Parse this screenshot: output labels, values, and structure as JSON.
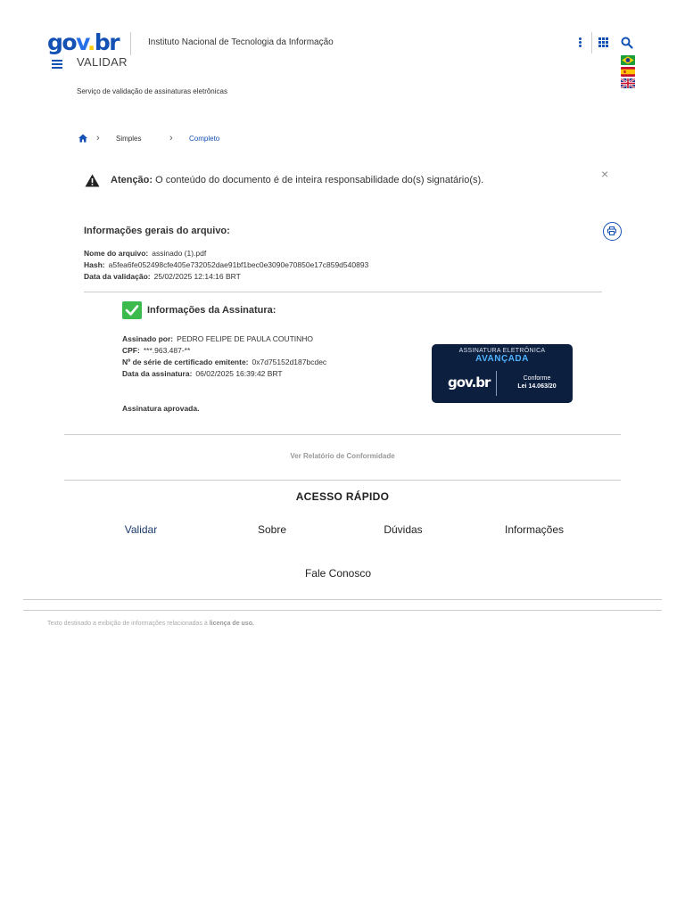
{
  "header": {
    "logo": {
      "g": "g",
      "o": "o",
      "v": "v",
      "dot": ".",
      "br": "br"
    },
    "institute": "Instituto Nacional de Tecnologia da Informação",
    "app_name": "VALIDAR",
    "subtitle": "Serviço de validação de assinaturas eletrônicas",
    "icons": [
      "kebab-icon",
      "grid-icon",
      "search-icon"
    ],
    "languages": [
      "flag-brazil",
      "flag-spain",
      "flag-uk"
    ]
  },
  "breadcrumb": {
    "items": [
      "Simples",
      "Completo"
    ]
  },
  "alert": {
    "label": "Atenção:",
    "message": "O conteúdo do documento é de inteira responsabilidade do(s) signatário(s).",
    "close": "×"
  },
  "file_info": {
    "title": "Informações gerais do arquivo:",
    "name_label": "Nome do arquivo:",
    "name_value": "assinado (1).pdf",
    "hash_label": "Hash:",
    "hash_value": "a5fea6fe052498cfe405e732052dae91bf1bec0e3090e70850e17c859d540893",
    "date_label": "Data da validação:",
    "date_value": "25/02/2025 12:14:16 BRT"
  },
  "signature": {
    "title": "Informações da Assinatura:",
    "signer_label": "Assinado por:",
    "signer_value": "PEDRO FELIPE DE PAULA COUTINHO",
    "cpf_label": "CPF:",
    "cpf_value": "***.963.487-**",
    "serial_label": "Nº de série de certificado emitente:",
    "serial_value": "0x7d75152d187bcdec",
    "date_label": "Data da assinatura:",
    "date_value": "06/02/2025 16:39:42 BRT",
    "status": "Assinatura aprovada."
  },
  "seal": {
    "top": "ASSINATURA ELETRÔNICA",
    "main": "AVANÇADA",
    "logo": "gov.br",
    "conf_line1": "Conforme",
    "conf_line2": "Lei 14.063/20"
  },
  "report_link": "Ver Relatório de Conformidade",
  "quick_access": {
    "title": "ACESSO RÁPIDO",
    "links": [
      "Validar",
      "Sobre",
      "Dúvidas",
      "Informações",
      "Fale Conosco"
    ]
  },
  "footer": {
    "text": "Texto destinado a exibição de informações relacionadas à",
    "link": "licença de uso."
  },
  "colors": {
    "primary": "#1351b4",
    "success": "#3dba4e",
    "seal_bg": "#0c1f3f"
  }
}
